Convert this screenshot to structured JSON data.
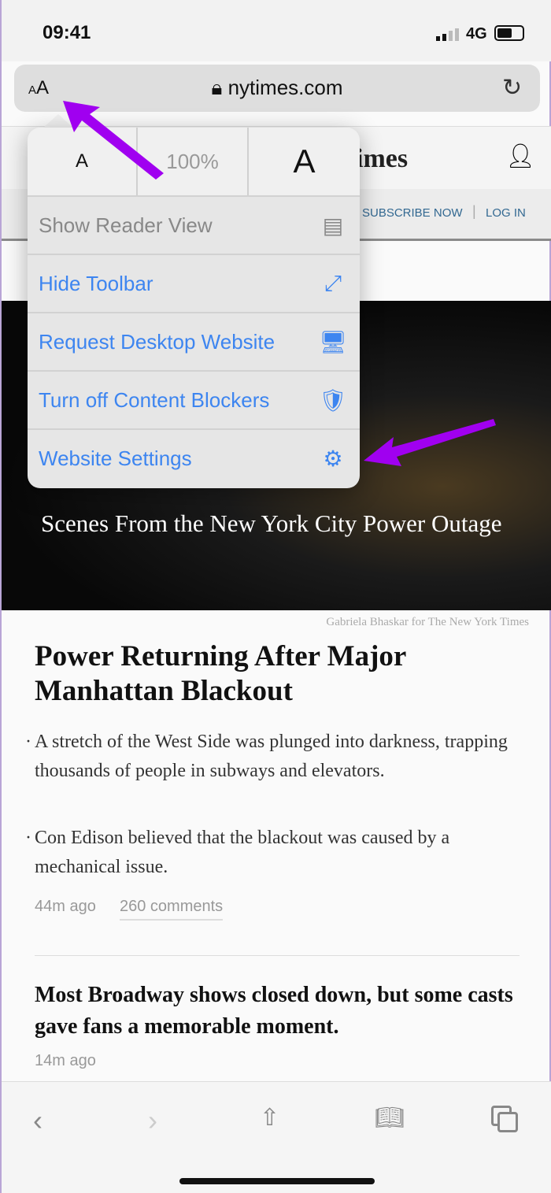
{
  "status_bar": {
    "time": "09:41",
    "network": "4G"
  },
  "url_bar": {
    "text_size_button": "AA",
    "domain": "nytimes.com",
    "lock_icon": "lock-icon",
    "reload_icon": "reload-icon"
  },
  "site_header": {
    "logo_partial": "imes",
    "account_icon": "person-icon",
    "subscribe": "SUBSCRIBE NOW",
    "separator": "|",
    "login": "LOG IN"
  },
  "popover": {
    "zoom": {
      "decrease": "A",
      "level": "100%",
      "increase": "A"
    },
    "items": [
      {
        "label": "Show Reader View",
        "icon": "reader-view-icon",
        "enabled": false
      },
      {
        "label": "Hide Toolbar",
        "icon": "resize-arrows-icon",
        "enabled": true
      },
      {
        "label": "Request Desktop Website",
        "icon": "monitor-icon",
        "enabled": true
      },
      {
        "label": "Turn off Content Blockers",
        "icon": "shield-icon",
        "enabled": true
      },
      {
        "label": "Website Settings",
        "icon": "gear-icon",
        "enabled": true
      }
    ],
    "accent_color": "#3d85f0"
  },
  "annotation_color": "#a000f0",
  "hero": {
    "title": "Scenes From the New York City Power Outage",
    "credit": "Gabriela Bhaskar for The New York Times"
  },
  "article1": {
    "headline": "Power Returning After Major Manhattan Blackout",
    "bullets": [
      "A stretch of the West Side was plunged into darkness, trapping thousands of people in subways and elevators.",
      "Con Edison believed that the blackout was caused by a mechanical issue."
    ],
    "time": "44m ago",
    "comments": "260 comments"
  },
  "article2": {
    "headline": "Most Broadway shows closed down, but some casts gave fans a memorable moment.",
    "time": "14m ago"
  },
  "toolbar": [
    "back",
    "forward",
    "share",
    "bookmarks",
    "tabs"
  ]
}
